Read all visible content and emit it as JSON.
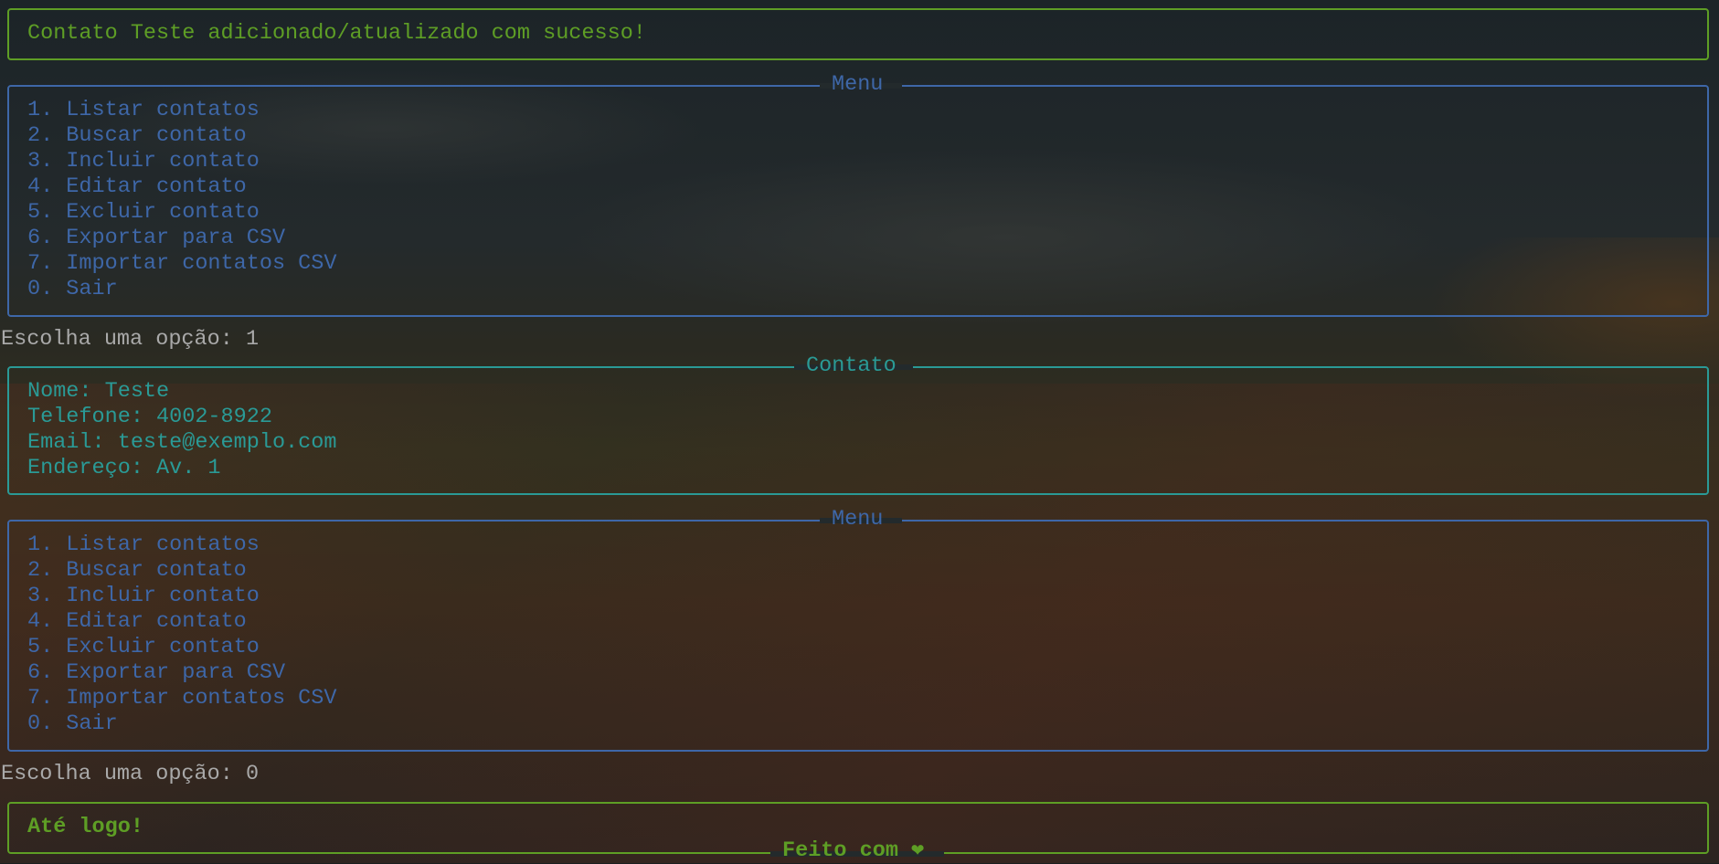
{
  "success_message": "Contato Teste adicionado/atualizado com sucesso!",
  "menu1": {
    "title": "Menu",
    "items": [
      "1. Listar contatos",
      "2. Buscar contato",
      "3. Incluir contato",
      "4. Editar contato",
      "5. Excluir contato",
      "6. Exportar para CSV",
      "7. Importar contatos CSV",
      "0. Sair"
    ]
  },
  "prompt1": "Escolha uma opção: 1",
  "contact": {
    "title": "Contato",
    "lines": [
      "Nome: Teste",
      "Telefone: 4002-8922",
      "Email: teste@exemplo.com",
      "Endereço: Av. 1"
    ]
  },
  "menu2": {
    "title": "Menu",
    "items": [
      "1. Listar contatos",
      "2. Buscar contato",
      "3. Incluir contato",
      "4. Editar contato",
      "5. Excluir contato",
      "6. Exportar para CSV",
      "7. Importar contatos CSV",
      "0. Sair"
    ]
  },
  "prompt2": "Escolha uma opção: 0",
  "goodbye": {
    "message": "Até logo!",
    "footer": "Feito com ❤"
  },
  "colors": {
    "success": "#5e9e25",
    "menu": "#3e67a8",
    "contact": "#2a9a96",
    "prompt": "#a9a9a9"
  }
}
